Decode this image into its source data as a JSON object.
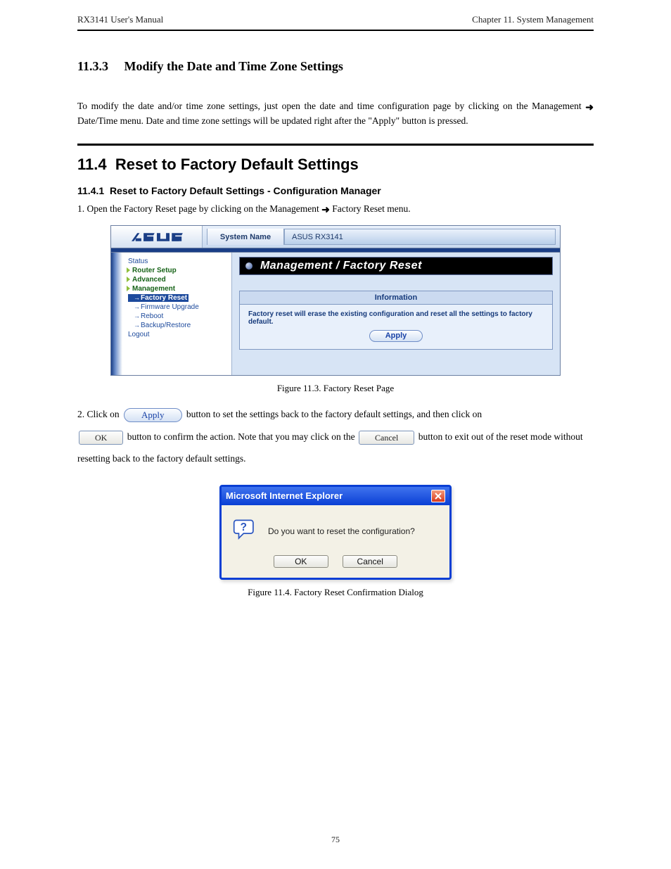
{
  "header": {
    "left": "RX3141 User's Manual",
    "right": "Chapter 11. System Management"
  },
  "section1": {
    "num": "11.3.3",
    "title": "Modify the Date and Time Zone Settings",
    "text_before": "To modify the date and/or time zone settings, just open the date and time configuration page by clicking on the Management ",
    "text_after": " Date/Time menu. Date and time zone settings will be updated right after the \"Apply\" button is pressed."
  },
  "section2": {
    "num": "11.4",
    "title": "Reset to Factory Default Settings",
    "subnum": "11.4.1",
    "subtitle": "Reset to Factory Default Settings - Configuration Manager",
    "step1_before": "1.  Open the Factory Reset page by clicking on the Management ",
    "step1_after": " Factory Reset menu."
  },
  "router": {
    "sysname_label": "System Name",
    "sysname_value": "ASUS RX3141",
    "nav": {
      "status": "Status",
      "router_setup": "Router Setup",
      "advanced": "Advanced",
      "management": "Management",
      "factory_reset": "Factory Reset",
      "firmware": "Firmware Upgrade",
      "reboot": "Reboot",
      "backup": "Backup/Restore",
      "logout": "Logout"
    },
    "main_title": "Management / Factory Reset",
    "info_head": "Information",
    "info_body": "Factory reset will erase the existing configuration and reset all the settings to factory default.",
    "apply": "Apply"
  },
  "fig1_caption": "Figure 11.3.  Factory Reset Page",
  "step2": {
    "line1_a": "2.  Click on ",
    "line1_b": " button to set the settings back to the factory default settings, and then click on ",
    "line2_a": "button to confirm the action. Note that you may click on the ",
    "line2_b": " button to exit out of the reset mode without",
    "line3": "resetting back to the factory default settings.",
    "apply": "Apply",
    "ok": "OK",
    "cancel": "Cancel"
  },
  "dialog": {
    "title": "Microsoft Internet Explorer",
    "message": "Do you want to reset the configuration?",
    "ok": "OK",
    "cancel": "Cancel"
  },
  "fig2_caption": "Figure 11.4.  Factory Reset Confirmation Dialog",
  "page_number": "75"
}
